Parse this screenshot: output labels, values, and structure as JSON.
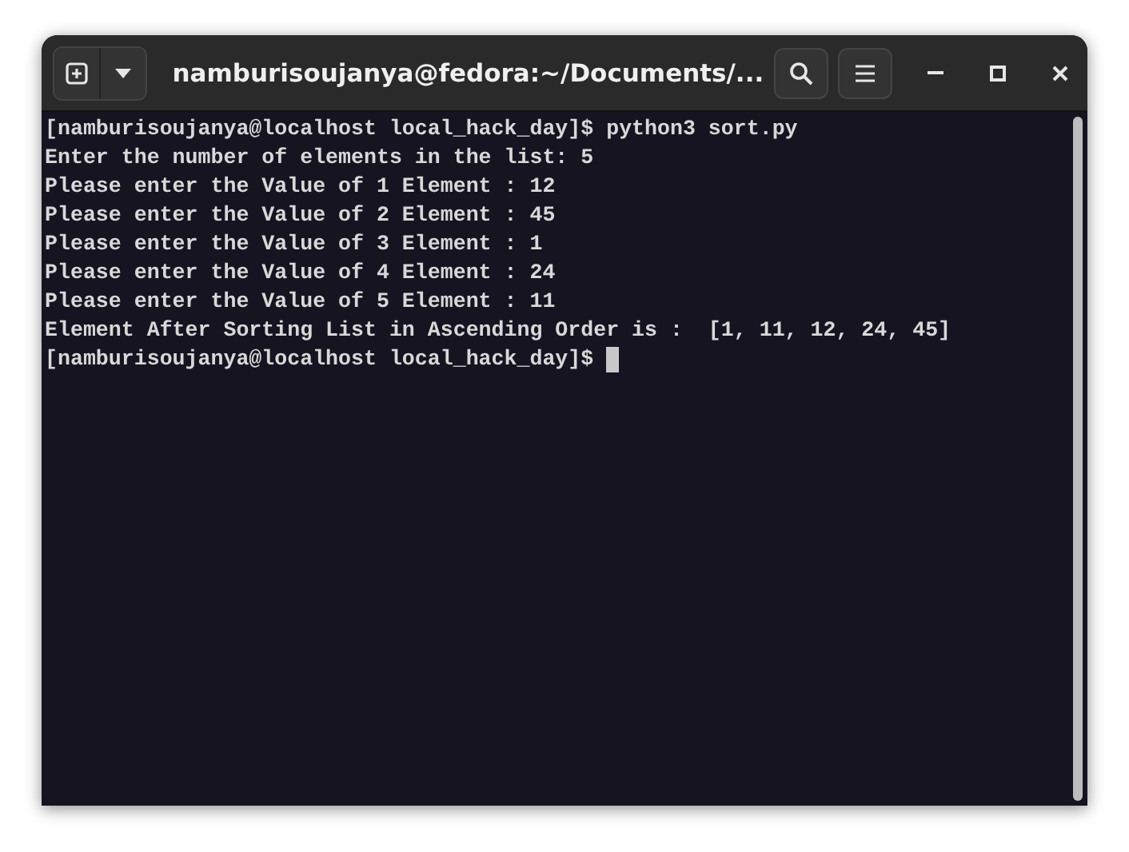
{
  "window": {
    "title": "namburisoujanya@fedora:~/Documents/..."
  },
  "terminal": {
    "lines": [
      {
        "text": "[namburisoujanya@localhost local_hack_day]$ python3 sort.py",
        "cursor": false
      },
      {
        "text": "Enter the number of elements in the list: 5",
        "cursor": false
      },
      {
        "text": "Please enter the Value of 1 Element : 12",
        "cursor": false
      },
      {
        "text": "Please enter the Value of 2 Element : 45",
        "cursor": false
      },
      {
        "text": "Please enter the Value of 3 Element : 1",
        "cursor": false
      },
      {
        "text": "Please enter the Value of 4 Element : 24",
        "cursor": false
      },
      {
        "text": "Please enter the Value of 5 Element : 11",
        "cursor": false
      },
      {
        "text": "Element After Sorting List in Ascending Order is :  [1, 11, 12, 24, 45]",
        "cursor": false
      },
      {
        "text": "[namburisoujanya@localhost local_hack_day]$",
        "cursor": true
      }
    ]
  }
}
